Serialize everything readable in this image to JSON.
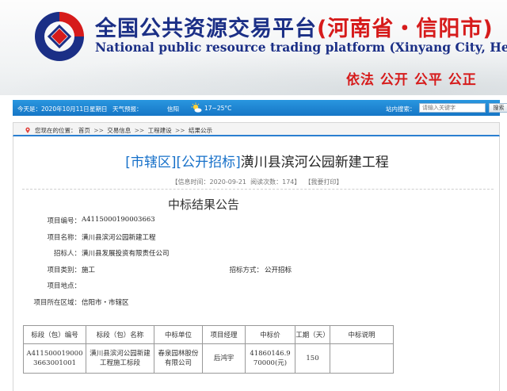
{
  "header": {
    "title_main": "全国公共资源交易平台",
    "title_city": "(河南省・信阳市)",
    "title_en": "National public resource trading platform (Xinyang City, Henan Province)",
    "motto": "依法 公开 公平 公正",
    "brand_color": "#1b2f86",
    "accent_color": "#d61b1b"
  },
  "topbar": {
    "date": "今天是：2020年10月11日",
    "weekday": "星期日",
    "weather_label": "天气预报：",
    "weather_city": "信阳",
    "weather_temp": "17~25°C",
    "search_label": "站内搜索：",
    "search_placeholder": "请输入关键字",
    "search_button": "搜索",
    "bar_color": "#1a7fcf"
  },
  "breadcrumb": {
    "prefix": "您现在的位置：",
    "items": [
      "首页",
      "交易信息",
      "工程建设",
      "结果公示"
    ]
  },
  "article": {
    "tag1": "[市辖区]",
    "tag2": "[公开招标]",
    "title": "潢川县滨河公园新建工程",
    "meta_date": "【信息时间：2020-09-21",
    "meta_views": "阅读次数：174】",
    "meta_print": "【我要打印】",
    "notice_title": "中标结果公告"
  },
  "fields": {
    "project_no_label": "项目编号：",
    "project_no": "A4115000190003663",
    "project_name_label": "项目名称：",
    "project_name": "潢川县滨河公园新建工程",
    "tenderer_label": "招标人：",
    "tenderer": "潢川县发展投资有限责任公司",
    "category_label": "项目类别：",
    "category": "施工",
    "method_label": "招标方式：",
    "method": "公开招标",
    "location_label": "项目地点：",
    "location": "",
    "region_label": "项目所在区域：",
    "region": "信阳市・市辖区"
  },
  "table": {
    "headers": [
      "标段（包）编号",
      "标段（包）名称",
      "中标单位",
      "项目经理",
      "中标价",
      "工期（天）",
      "中标说明"
    ],
    "row": {
      "code": "A4115000190003663001001",
      "name": "潢川县滨河公园新建工程施工标段",
      "winner": "春泉园林股份有限公司",
      "manager": "后鸿宇",
      "price": "41860146.970000(元)",
      "duration": "150",
      "remark": ""
    }
  }
}
